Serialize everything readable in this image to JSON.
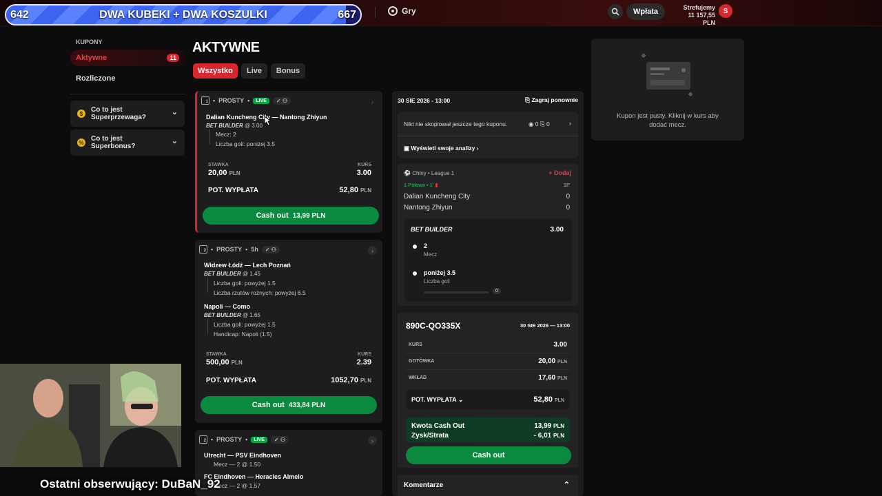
{
  "stream": {
    "left_count": "642",
    "right_count": "667",
    "goal_title": "DWA KUBEKI + DWA KOSZULKI",
    "progress_fraction": 0.96,
    "last_follower": "Ostatni obserwujący: DuBaN_92"
  },
  "header": {
    "games_label": "Gry",
    "deposit_label": "Wpłata",
    "user_name": "Strefujemy",
    "balance": "11 157,55 PLN",
    "avatar_letter": "S"
  },
  "sidebar": {
    "heading": "KUPONY",
    "active_label": "Aktywne",
    "active_count": "11",
    "settled_label": "Rozliczone",
    "faq1": "Co to jest Superprzewaga?",
    "faq2": "Co to jest Superbonus?"
  },
  "main": {
    "title": "AKTYWNE",
    "tabs": [
      "Wszystko",
      "Live",
      "Bonus"
    ]
  },
  "coupons": [
    {
      "num": "1",
      "type": "PROSTY",
      "status": "LIVE",
      "match": "Dalian Kuncheng City — Nantong Zhiyun",
      "bb_label": "BET BUILDER",
      "bb_odds": "@ 3.00",
      "legs": [
        "Mecz: 2",
        "Liczba goli: poniżej 3.5"
      ],
      "stake_label": "STAWKA",
      "stake": "20,00",
      "odds_label": "KURS",
      "odds": "3.00",
      "payout_label": "POT. WYPŁATA",
      "payout": "52,80",
      "cashout_label": "Cash out",
      "cashout_amount": "13,99 PLN",
      "currency": "PLN"
    },
    {
      "num": "2",
      "type": "PROSTY",
      "time": "5h",
      "match1": "Widzew Łódź — Lech Poznań",
      "bb1_odds": "@ 1.45",
      "legs1": [
        "Liczba goli: powyżej 1.5",
        "Liczba rzutów rożnych: powyżej 6.5"
      ],
      "match2": "Napoli — Como",
      "bb2_odds": "@ 1.65",
      "legs2": [
        "Liczba goli: powyżej 1.5",
        "Handicap: Napoli (1.5)"
      ],
      "stake": "500,00",
      "odds": "2.39",
      "payout": "1052,70",
      "cashout_amount": "433,84 PLN"
    },
    {
      "num": "2",
      "type": "PROSTY",
      "status": "LIVE",
      "match1": "Utrecht — PSV Eindhoven",
      "leg1": "Mecz — 2 @ 1.50",
      "match2": "FC Eindhoven — Heracles Almelo",
      "leg2": "Mecz — 2 @ 1.57"
    }
  ],
  "detail": {
    "date": "30 SIE 2026 - 13:00",
    "replay_label": "Zagraj ponownie",
    "copy_text": "Nikt nie skopiował jeszcze tego kuponu.",
    "views": "0",
    "copies": "0",
    "analysis_link": "Wyświetl swoje analizy ›",
    "league": "Chiny • League 1",
    "add_label": "Dodaj",
    "period": "1.Połowa • 1'",
    "period_right": "1P",
    "home_team": "Dalian Kuncheng City",
    "home_score": "0",
    "away_team": "Nantong Zhiyun",
    "away_score": "0",
    "bb_title": "BET BUILDER",
    "bb_odds": "3.00",
    "sel1_value": "2",
    "sel1_market": "Mecz",
    "sel2_value": "poniżej 3.5",
    "sel2_market": "Liczba goli",
    "sel2_progress": "0",
    "coupon_code": "890C-QO335X",
    "coupon_date": "30 SIE 2026 — 13:00",
    "kurs_label": "KURS",
    "kurs_value": "3.00",
    "cash_label": "GOTÓWKA",
    "cash_value": "20,00",
    "stake_label": "WKŁAD",
    "stake_value": "17,60",
    "payout_label": "POT. WYPŁATA",
    "payout_value": "52,80",
    "currency": "PLN",
    "co_label": "Kwota Cash Out",
    "co_value": "13,99",
    "pl_label": "Zysk/Strata",
    "pl_value": "- 6,01",
    "cashout_button": "Cash out",
    "comments_label": "Komentarze"
  },
  "betslip": {
    "empty_text": "Kupon jest pusty. Kliknij w kurs aby dodać mecz."
  },
  "colors": {
    "accent": "#d8282e",
    "cashout_green": "#0a8a3f",
    "live_green": "#0da346",
    "goal_bar": "#3d64f0"
  }
}
